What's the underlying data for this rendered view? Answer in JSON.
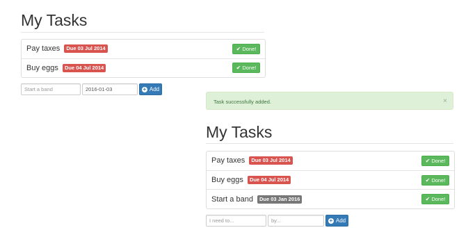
{
  "left": {
    "title": "My Tasks",
    "tasks": [
      {
        "name": "Pay taxes",
        "due": "Due 03 Jul 2014",
        "done_label": "Done!"
      },
      {
        "name": "Buy eggs",
        "due": "Due 04 Jul 2014",
        "done_label": "Done!"
      }
    ],
    "form": {
      "task_placeholder": "Start a band",
      "task_value": "",
      "date_value": "2016-01-03",
      "add_label": "Add"
    }
  },
  "right": {
    "alert": {
      "message": "Task successfully added.",
      "close": "×"
    },
    "title": "My Tasks",
    "tasks": [
      {
        "name": "Pay taxes",
        "due": "Due 03 Jul 2014",
        "done_label": "Done!"
      },
      {
        "name": "Buy eggs",
        "due": "Due 04 Jul 2014",
        "done_label": "Done!"
      },
      {
        "name": "Start a band",
        "due": "Due 03 Jan 2016",
        "done_label": "Done!"
      }
    ],
    "form": {
      "task_placeholder": "I need to...",
      "date_placeholder": "by...",
      "add_label": "Add"
    }
  },
  "icons": {
    "check": "check-icon",
    "plus": "plus-circle-icon",
    "close": "close-icon"
  },
  "colors": {
    "overdue_badge": "#d9534f",
    "upcoming_badge": "#777777",
    "done_button": "#5cb85c",
    "add_button": "#337ab7",
    "alert_bg": "#dff0d8"
  }
}
